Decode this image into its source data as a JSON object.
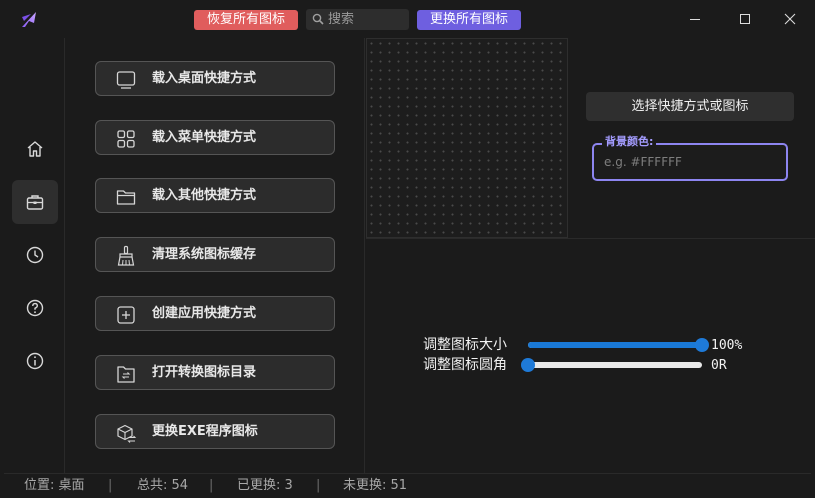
{
  "titlebar": {
    "restore_all_label": "恢复所有图标",
    "search_placeholder": "搜索",
    "replace_all_label": "更换所有图标"
  },
  "sidebar": {
    "items": [
      {
        "name": "home",
        "icon": "home-icon",
        "active": false
      },
      {
        "name": "toolbox",
        "icon": "toolbox-icon",
        "active": true
      },
      {
        "name": "history",
        "icon": "clock-icon",
        "active": false
      },
      {
        "name": "help",
        "icon": "help-icon",
        "active": false
      },
      {
        "name": "about",
        "icon": "info-icon",
        "active": false
      }
    ]
  },
  "actions": {
    "items": [
      {
        "label": "载入桌面快捷方式",
        "icon": "monitor-icon"
      },
      {
        "label": "载入菜单快捷方式",
        "icon": "grid-icon"
      },
      {
        "label": "载入其他快捷方式",
        "icon": "folder-icon"
      },
      {
        "label": "清理系统图标缓存",
        "icon": "broom-icon"
      },
      {
        "label": "创建应用快捷方式",
        "icon": "add-square-icon"
      },
      {
        "label": "打开转换图标目录",
        "icon": "folder-convert-icon"
      },
      {
        "label": "更换EXE程序图标",
        "icon": "box-swap-icon"
      }
    ]
  },
  "editor": {
    "select_label": "选择快捷方式或图标",
    "bg_color_label": "背景颜色:",
    "bg_color_placeholder": "e.g. #FFFFFF",
    "size_label": "调整图标大小",
    "size_value": "100%",
    "size_level": 1.0,
    "radius_label": "调整图标圆角",
    "radius_value": "0R",
    "radius_level": 0.0
  },
  "status": {
    "location": "位置: 桌面",
    "total": "总共: 54",
    "replaced": "已更换: 3",
    "not_replaced": "未更换: 51",
    "separator": "|"
  },
  "colors": {
    "restore_button": "#e05d5d",
    "replace_button": "#6e5fe0",
    "accent_field": "#8d85f0",
    "slider_fill": "#1a79d6",
    "background": "#1b1b1b"
  }
}
